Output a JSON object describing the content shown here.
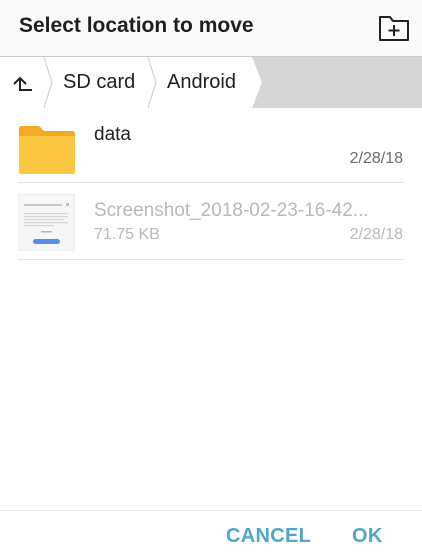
{
  "dialog": {
    "title": "Select location to move",
    "new_folder_icon": "new-folder-icon"
  },
  "breadcrumb": {
    "up_icon": "up-arrow-icon",
    "items": [
      {
        "label": "SD card"
      },
      {
        "label": "Android"
      }
    ]
  },
  "files": [
    {
      "name": "data",
      "type": "folder",
      "icon": "folder-icon",
      "date": "2/28/18",
      "enabled": true
    },
    {
      "name": "Screenshot_2018-02-23-16-42...",
      "type": "image",
      "icon": "image-thumbnail",
      "size": "71.75 KB",
      "date": "2/28/18",
      "enabled": false
    }
  ],
  "actions": {
    "cancel": "CANCEL",
    "ok": "OK"
  },
  "colors": {
    "accent": "#4fa6c9",
    "folder": "#f9c23c",
    "breadcrumb_bg": "#d6d6d6",
    "disabled_text": "#b8b8b8"
  }
}
